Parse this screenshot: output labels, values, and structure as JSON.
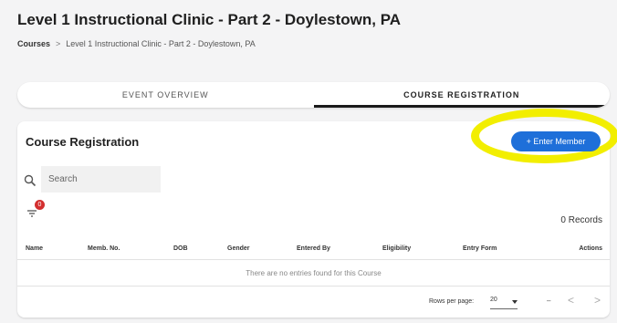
{
  "page": {
    "title": "Level 1 Instructional Clinic - Part 2 - Doylestown, PA"
  },
  "breadcrumb": {
    "root": "Courses",
    "separator": ">",
    "current": "Level 1 Instructional Clinic - Part 2 - Doylestown, PA"
  },
  "tabs": [
    {
      "label": "EVENT OVERVIEW",
      "active": false
    },
    {
      "label": "COURSE REGISTRATION",
      "active": true
    }
  ],
  "card": {
    "title": "Course Registration",
    "enter_member_label": "+ Enter Member",
    "search_placeholder": "Search",
    "filter_count": "0",
    "records_text": "0 Records"
  },
  "table": {
    "columns": [
      "Name",
      "Memb. No.",
      "DOB",
      "Gender",
      "Entered By",
      "Eligibility",
      "Entry Form",
      "Actions"
    ],
    "empty_message": "There are no entries found for this Course"
  },
  "pagination": {
    "rows_per_page_label": "Rows per page:",
    "rows_per_page_value": "20",
    "range_text": "–",
    "prev_glyph": "<",
    "next_glyph": ">"
  },
  "colors": {
    "accent": "#1e6fd9",
    "highlight": "#f2ee00",
    "badge": "#d32f2f"
  },
  "icons": [
    "search-icon",
    "filter-icon",
    "chevron-down-icon",
    "chevron-left-icon",
    "chevron-right-icon"
  ]
}
